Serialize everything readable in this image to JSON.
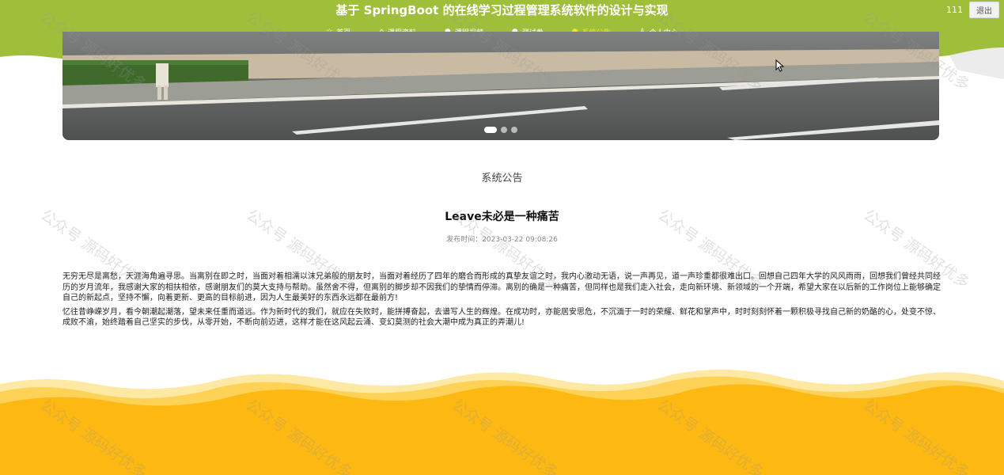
{
  "header": {
    "title": "基于 SpringBoot 的在线学习过程管理系统软件的设计与实现",
    "username": "111",
    "logout_label": "退出"
  },
  "nav": {
    "items": [
      {
        "label": "首页",
        "icon": "home-icon"
      },
      {
        "label": "课程资料",
        "icon": "book-icon"
      },
      {
        "label": "课程视频",
        "icon": "video-icon"
      },
      {
        "label": "测试卷",
        "icon": "exam-icon"
      },
      {
        "label": "系统公告",
        "icon": "notice-icon"
      },
      {
        "label": "个人中心",
        "icon": "user-icon"
      }
    ],
    "active_index": 4
  },
  "banner": {
    "slide_count": 3,
    "active_slide": 1
  },
  "section": {
    "title": "系统公告"
  },
  "article": {
    "title": "Leave未必是一种痛苦",
    "publish_label": "发布时间：",
    "publish_time": "2023-03-22 09:08:26",
    "paragraphs": [
      "无穷无尽是离愁，天涯海角遍寻思。当离别在即之时，当面对着相濡以沫兄弟般的朋友时，当面对着经历了四年的磨合而形成的真挚友谊之时，我内心激动无语，说一声再见，道一声珍重都很难出口。回想自己四年大学的风风雨雨，回想我们曾经共同经历的岁月流年，我感谢大家的相扶相依，感谢朋友们的莫大支持与帮助。虽然舍不得，但离别的脚步却不因我们的挚情而停滞。离别的确是一种痛苦，但同样也是我们走入社会，走向新环境、新领域的一个开端，希望大家在以后新的工作岗位上能够确定自己的新起点，坚持不懈，向着更新、更高的目标前进，因为人生最美好的东西永远都在最前方!",
      "忆往昔峥嵘岁月，看今朝潮起潮落，望未来任重而道远。作为新时代的我们，就应在失败时，能拼搏奋起，去谱写人生的辉煌。在成功时，亦能居安思危，不沉湎于一时的荣耀、鲜花和掌声中，时时刻刻怀着一颗积极寻找自己新的奶酪的心，处变不惊、成败不渝，始终踏着自己坚实的步伐，从零开始，不断向前迈进，这样才能在这风起云涌、变幻莫测的社会大潮中成为真正的弄潮儿!"
    ]
  },
  "watermark": {
    "text": "公众号 源码好优多"
  },
  "colors": {
    "header_green": "#9fbf3b",
    "footer_yellow": "#fdb812",
    "active_nav": "#f7e51f"
  }
}
